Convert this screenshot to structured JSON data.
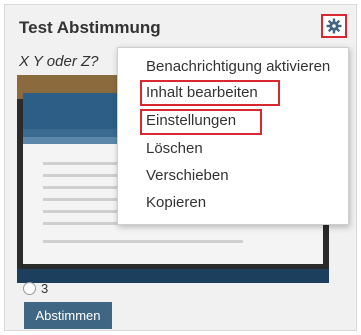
{
  "widget": {
    "title": "Test Abstimmung",
    "question": "X Y oder Z?"
  },
  "menu": {
    "items": [
      {
        "label": "Benachrichtigung aktivieren"
      },
      {
        "label": "Inhalt bearbeiten"
      },
      {
        "label": "Einstellungen"
      },
      {
        "label": "Löschen"
      },
      {
        "label": "Verschieben"
      },
      {
        "label": "Kopieren"
      }
    ]
  },
  "poll": {
    "option_label": "3",
    "vote_button": "Abstimmen"
  },
  "colors": {
    "highlight": "#d9282f",
    "button": "#3f6682"
  },
  "icons": {
    "settings": "gear-icon"
  }
}
